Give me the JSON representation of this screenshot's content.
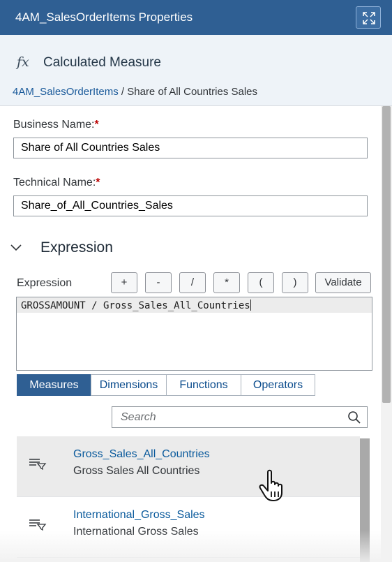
{
  "panel": {
    "title": "4AM_SalesOrderItems Properties",
    "object_type": "Calculated Measure",
    "object_icon": "fx",
    "breadcrumb": {
      "parent": "4AM_SalesOrderItems",
      "separator": " / ",
      "current": "Share of All Countries Sales"
    }
  },
  "form": {
    "business_name": {
      "label": "Business Name:",
      "required_mark": "*",
      "value": "Share of All Countries Sales"
    },
    "technical_name": {
      "label": "Technical Name:",
      "required_mark": "*",
      "value": "Share_of_All_Countries_Sales"
    }
  },
  "expression": {
    "section_title": "Expression",
    "label": "Expression",
    "operators": [
      "+",
      "-",
      "/",
      "*",
      "(",
      ")"
    ],
    "validate_label": "Validate",
    "code": "GROSSAMOUNT / Gross_Sales_All_Countries"
  },
  "tabs": [
    {
      "label": "Measures",
      "active": true
    },
    {
      "label": "Dimensions",
      "active": false
    },
    {
      "label": "Functions",
      "active": false
    },
    {
      "label": "Operators",
      "active": false
    }
  ],
  "search": {
    "placeholder": "Search"
  },
  "measures": [
    {
      "name": "Gross_Sales_All_Countries",
      "description": "Gross Sales All Countries",
      "selected": true
    },
    {
      "name": "International_Gross_Sales",
      "description": "International Gross Sales",
      "selected": false
    }
  ],
  "colors": {
    "header_blue": "#2f5f93",
    "link_blue": "#0a5a9c",
    "required_red": "#bb0000"
  }
}
